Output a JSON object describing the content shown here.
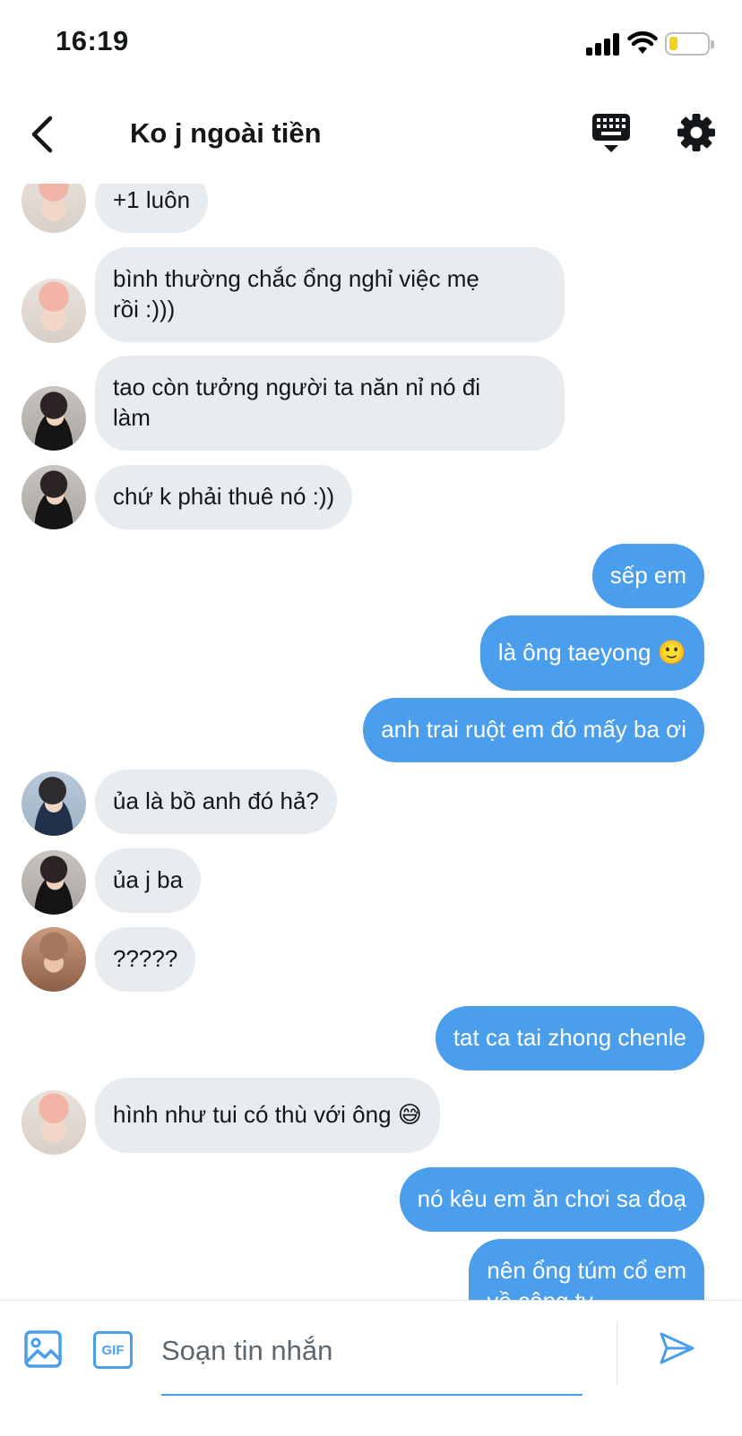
{
  "status_bar": {
    "time": "16:19"
  },
  "header": {
    "title": "Ko j ngoài tiền"
  },
  "messages": [
    {
      "text": "+1 luôn"
    },
    {
      "text": "bình thường chắc ổng nghỉ việc mẹ\nrồi :)))"
    },
    {
      "text": "tao còn tưởng người ta năn nỉ nó đi\nlàm"
    },
    {
      "text": "chứ k phải thuê nó :))"
    },
    {
      "text": "sếp em"
    },
    {
      "text": "là ông taeyong 🙂"
    },
    {
      "text": "anh trai ruột em đó mấy ba ơi"
    },
    {
      "text": "ủa là bồ anh đó hả?"
    },
    {
      "text": "ủa j ba"
    },
    {
      "text": "?????"
    },
    {
      "text": "tat ca tai zhong chenle"
    },
    {
      "text": "hình như tui có thù với ông 😅"
    },
    {
      "text": "nó kêu em ăn chơi sa đoạ"
    },
    {
      "text": "nên ổng túm cổ em\nvề công ty"
    }
  ],
  "composer": {
    "gif_label": "GIF",
    "placeholder": "Soạn tin nhắn"
  },
  "colors": {
    "outgoing_bubble": "#4a9eec",
    "incoming_bubble": "#e6ecf0",
    "accent": "#4a9eec"
  },
  "icons": [
    "back-arrow-icon",
    "keyboard-icon",
    "gear-icon",
    "image-icon",
    "send-icon"
  ]
}
